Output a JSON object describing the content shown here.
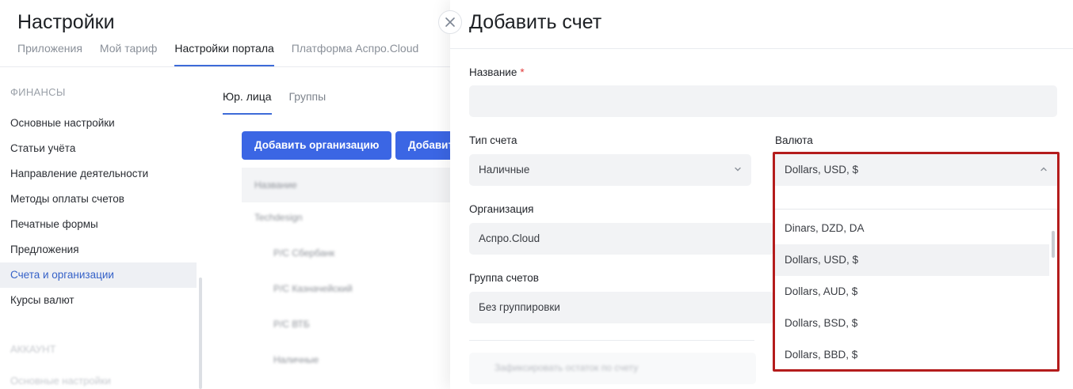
{
  "page": {
    "title": "Настройки",
    "tabs": [
      {
        "label": "Приложения",
        "active": false
      },
      {
        "label": "Мой тариф",
        "active": false
      },
      {
        "label": "Настройки портала",
        "active": true
      },
      {
        "label": "Платформа Аспро.Cloud",
        "active": false
      }
    ]
  },
  "sidebar": {
    "section": "ФИНАНСЫ",
    "items": [
      {
        "label": "Основные настройки",
        "active": false
      },
      {
        "label": "Статьи учёта",
        "active": false
      },
      {
        "label": "Направление деятельности",
        "active": false
      },
      {
        "label": "Методы оплаты счетов",
        "active": false
      },
      {
        "label": "Печатные формы",
        "active": false
      },
      {
        "label": "Предложения",
        "active": false
      },
      {
        "label": "Счета и организации",
        "active": true
      },
      {
        "label": "Курсы валют",
        "active": false
      }
    ],
    "faded_section": "АККАУНТ",
    "faded_item": "Основные настройки"
  },
  "content": {
    "tabs": [
      {
        "label": "Юр. лица",
        "active": true
      },
      {
        "label": "Группы",
        "active": false
      }
    ],
    "add_org_button": "Добавить организацию",
    "add_button": "Добавить",
    "table": {
      "header": "Название",
      "rows": [
        "Techdesign",
        "Р/С Сбербанк",
        "Р/С Казначейский",
        "Р/С ВТБ",
        "Наличные"
      ]
    }
  },
  "drawer": {
    "title": "Добавить счет",
    "name_label": "Название",
    "name_value": "",
    "account_type_label": "Тип счета",
    "account_type_value": "Наличные",
    "currency_label": "Валюта",
    "currency_value": "Dollars, USD, $",
    "organization_label": "Организация",
    "organization_value": "Аспро.Cloud",
    "group_label": "Группа счетов",
    "group_value": "Без группировки",
    "faded_check_label": "Зафиксировать остаток по счету",
    "currency_options": [
      {
        "label": "Dinars, DZD, DA",
        "selected": false
      },
      {
        "label": "Dollars, USD, $",
        "selected": true
      },
      {
        "label": "Dollars, AUD, $",
        "selected": false
      },
      {
        "label": "Dollars, BSD, $",
        "selected": false
      },
      {
        "label": "Dollars, BBD, $",
        "selected": false
      }
    ]
  },
  "colors": {
    "accent": "#3b66e4",
    "highlight_border": "#b41c1c",
    "required": "#e23d3d"
  }
}
